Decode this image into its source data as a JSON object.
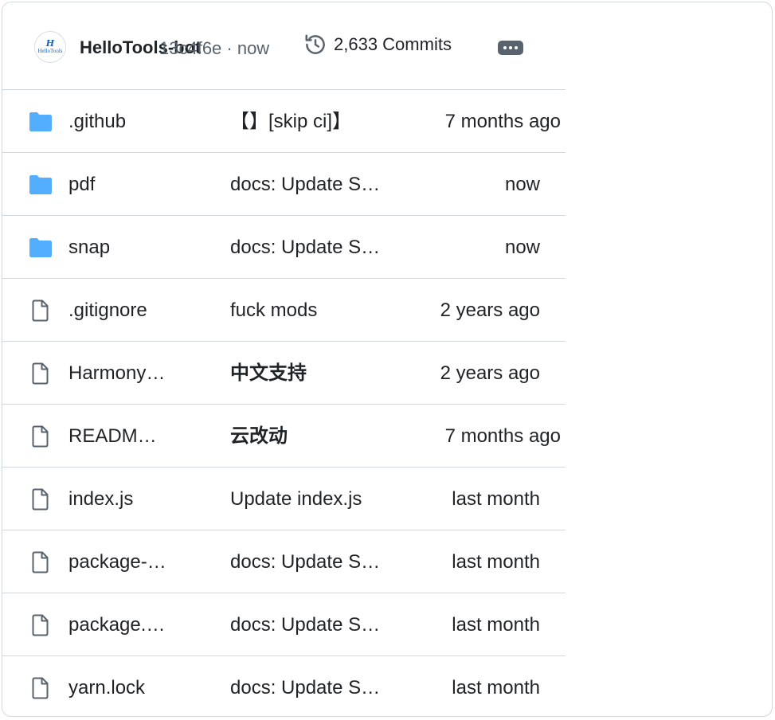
{
  "header": {
    "author": "HelloTools-bot",
    "commit_hash": "13c4f6e",
    "commit_time": "now",
    "commit_meta": "13c4f6e · now",
    "commits_label": "2,633 Commits",
    "avatar_initial": "H",
    "avatar_text": "HelloTools"
  },
  "colors": {
    "folder": "#54aeff",
    "file_icon": "#59636e",
    "border": "#d0d7de",
    "text": "#1f2328"
  },
  "files": [
    {
      "type": "folder",
      "icon": "folder-icon",
      "name": ".github",
      "message": "【】[skip ci]】",
      "time": "7 months ago"
    },
    {
      "type": "folder",
      "icon": "folder-icon",
      "name": "pdf",
      "message": "docs: Update S…",
      "time": "now"
    },
    {
      "type": "folder",
      "icon": "folder-icon",
      "name": "snap",
      "message": "docs: Update S…",
      "time": "now"
    },
    {
      "type": "file",
      "icon": "file-icon",
      "name": ".gitignore",
      "message": "fuck mods",
      "time": "2 years ago"
    },
    {
      "type": "file",
      "icon": "file-icon",
      "name": "Harmony…",
      "message": "中文支持",
      "time": "2 years ago"
    },
    {
      "type": "file",
      "icon": "file-icon",
      "name": "READM…",
      "message": "云改动",
      "time": "7 months ago"
    },
    {
      "type": "file",
      "icon": "file-icon",
      "name": "index.js",
      "message": "Update index.js",
      "time": "last month"
    },
    {
      "type": "file",
      "icon": "file-icon",
      "name": "package-…",
      "message": "docs: Update S…",
      "time": "last month"
    },
    {
      "type": "file",
      "icon": "file-icon",
      "name": "package.…",
      "message": "docs: Update S…",
      "time": "last month"
    },
    {
      "type": "file",
      "icon": "file-icon",
      "name": "yarn.lock",
      "message": "docs: Update S…",
      "time": "last month"
    }
  ]
}
